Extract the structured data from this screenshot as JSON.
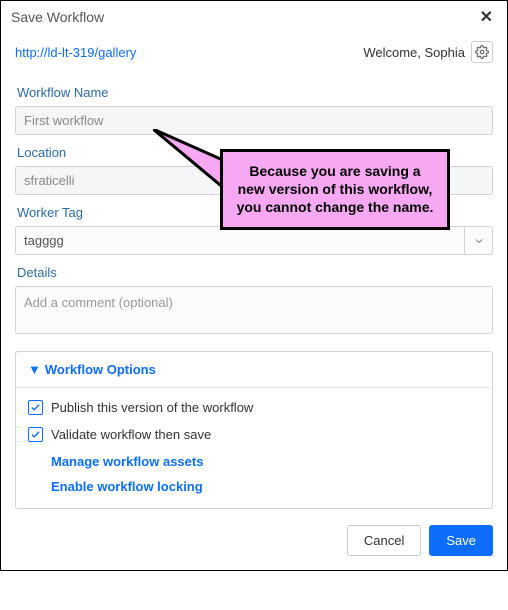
{
  "dialog": {
    "title": "Save Workflow"
  },
  "breadcrumb": "http://ld-lt-319/gallery",
  "welcome": "Welcome, Sophia",
  "fields": {
    "name_label": "Workflow Name",
    "name_value": "First workflow",
    "location_label": "Location",
    "location_value": "sfraticelli",
    "tag_label": "Worker Tag",
    "tag_value": "tagggg",
    "details_label": "Details",
    "details_placeholder": "Add a comment (optional)"
  },
  "options": {
    "header": "Workflow Options",
    "publish": "Publish this version of the workflow",
    "validate": "Validate workflow then save",
    "manage_assets": "Manage workflow assets",
    "enable_locking": "Enable workflow locking"
  },
  "buttons": {
    "cancel": "Cancel",
    "save": "Save"
  },
  "annotation": "Because you are saving a new version of this workflow, you cannot change the name."
}
